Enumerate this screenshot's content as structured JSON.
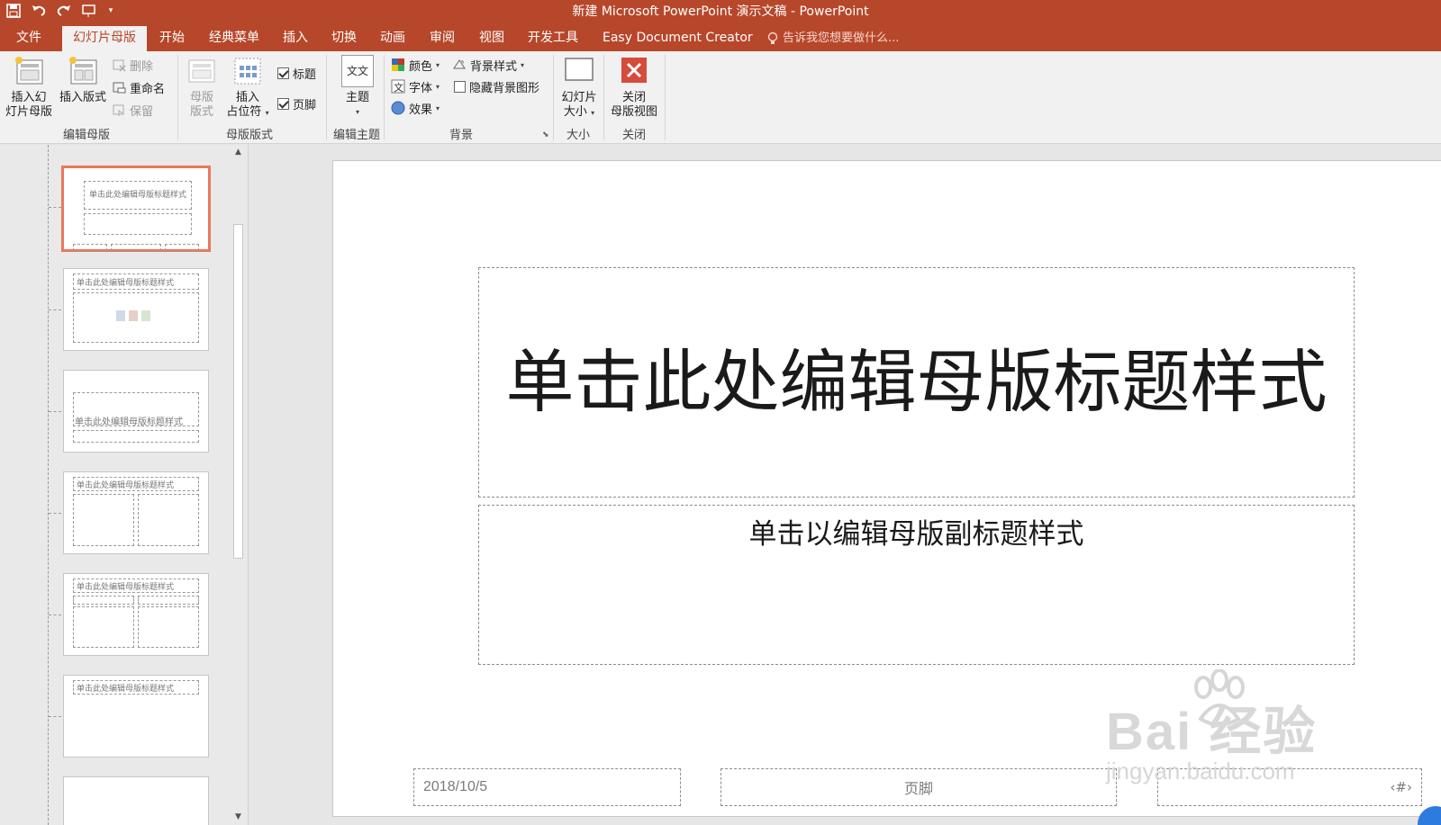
{
  "window": {
    "title": "新建 Microsoft PowerPoint 演示文稿 - PowerPoint"
  },
  "qat": {
    "icons": [
      "save-icon",
      "undo-icon",
      "redo-icon",
      "slideshow-from-start-icon",
      "customize-qat-icon"
    ]
  },
  "tabs": [
    {
      "label": "文件",
      "active": false
    },
    {
      "label": "幻灯片母版",
      "active": true
    },
    {
      "label": "开始",
      "active": false
    },
    {
      "label": "经典菜单",
      "active": false
    },
    {
      "label": "插入",
      "active": false
    },
    {
      "label": "切换",
      "active": false
    },
    {
      "label": "动画",
      "active": false
    },
    {
      "label": "审阅",
      "active": false
    },
    {
      "label": "视图",
      "active": false
    },
    {
      "label": "开发工具",
      "active": false
    },
    {
      "label": "Easy Document Creator",
      "active": false
    }
  ],
  "tell_me": {
    "placeholder": "告诉我您想要做什么...",
    "icon": "lightbulb-icon"
  },
  "ribbon": {
    "edit_master": {
      "label": "编辑母版",
      "insert_master_l1": "插入幻",
      "insert_master_l2": "灯片母版",
      "insert_layout": "插入版式",
      "delete": "删除",
      "rename": "重命名",
      "preserve": "保留"
    },
    "master_layout": {
      "label": "母版版式",
      "master_layout_l1": "母版",
      "master_layout_l2": "版式",
      "insert_placeholder_l1": "插入",
      "insert_placeholder_l2": "占位符",
      "title_chk": "标题",
      "footer_chk": "页脚",
      "title_checked": true,
      "footer_checked": true
    },
    "edit_theme": {
      "label": "编辑主题",
      "theme": "主题",
      "theme_icon_text": "文文"
    },
    "background": {
      "label": "背景",
      "colors": "颜色",
      "fonts": "字体",
      "effects": "效果",
      "bg_styles": "背景样式",
      "hide_bg": "隐藏背景图形",
      "hide_bg_checked": false
    },
    "size": {
      "label": "大小",
      "slide_size_l1": "幻灯片",
      "slide_size_l2": "大小"
    },
    "close": {
      "label": "关闭",
      "close_l1": "关闭",
      "close_l2": "母版视图"
    }
  },
  "thumbnails": [
    {
      "title": "单击此处编辑母版标题样式",
      "selected": true,
      "kind": "title-master"
    },
    {
      "title": "单击此处编辑母版标题样式",
      "selected": false,
      "kind": "title-content"
    },
    {
      "title": "单击此处编辑母版标题样式",
      "selected": false,
      "kind": "section"
    },
    {
      "title": "单击此处编辑母版标题样式",
      "selected": false,
      "kind": "two-content"
    },
    {
      "title": "单击此处编辑母版标题样式",
      "selected": false,
      "kind": "comparison"
    },
    {
      "title": "单击此处编辑母版标题样式",
      "selected": false,
      "kind": "title-only"
    },
    {
      "title": "",
      "selected": false,
      "kind": "blank"
    }
  ],
  "slide": {
    "title": "单击此处编辑母版标题样式",
    "subtitle": "单击以编辑母版副标题样式",
    "date": "2018/10/5",
    "footer": "页脚",
    "slide_number": "‹#›"
  },
  "watermark": {
    "brand": "Bai 经验",
    "url": "jingyan.baidu.com"
  },
  "colors": {
    "accent": "#b7472a",
    "selection": "#e8795b",
    "close_red": "#d64b3c"
  }
}
